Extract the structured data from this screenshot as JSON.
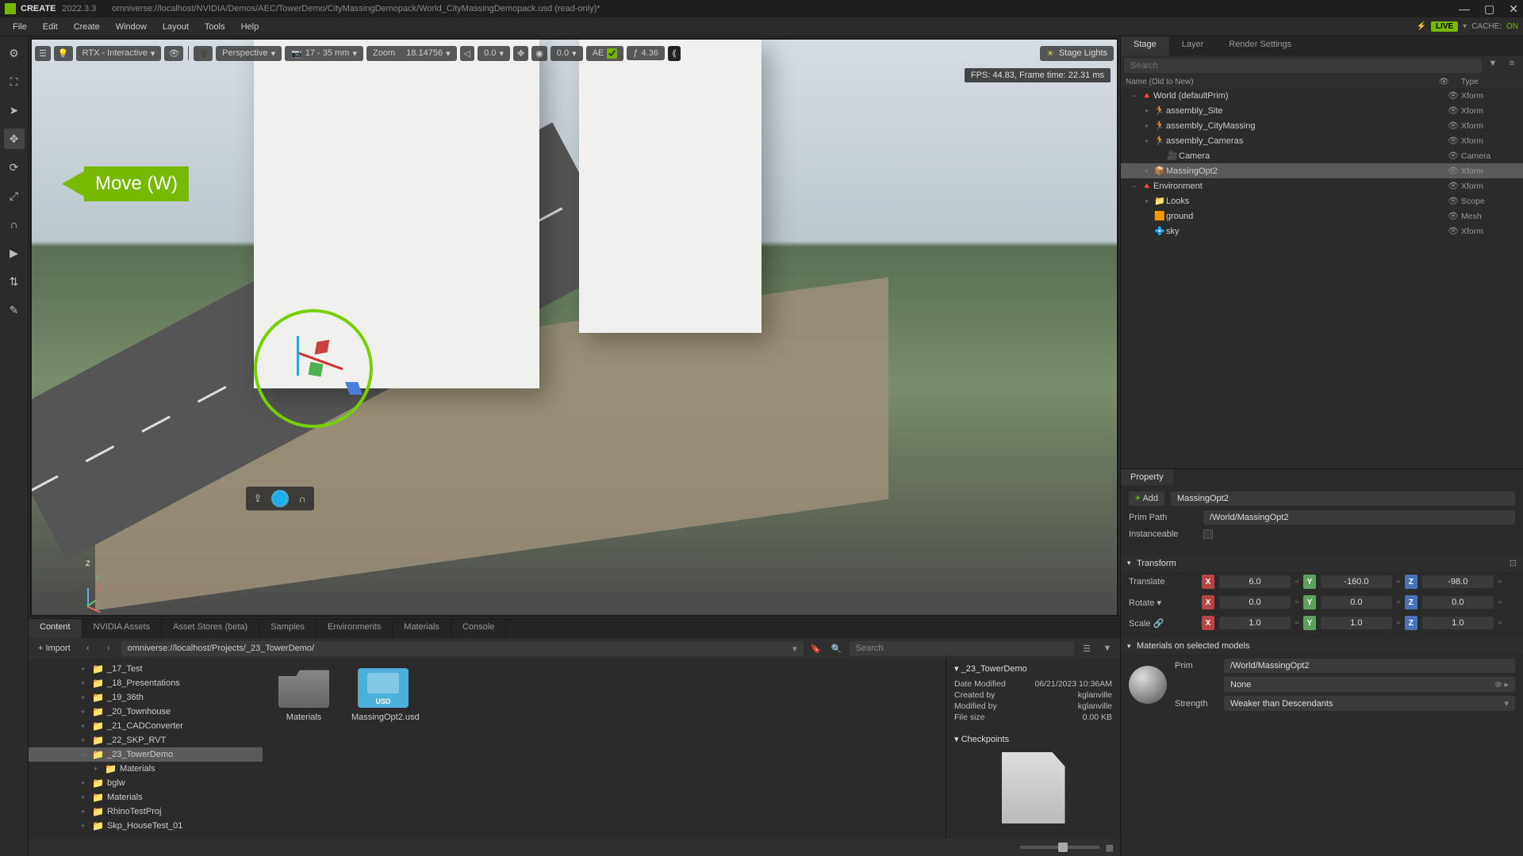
{
  "titlebar": {
    "app": "CREATE",
    "version": "2022.3.3",
    "path": "omniverse://localhost/NVIDIA/Demos/AEC/TowerDemo/CityMassingDemopack/World_CityMassingDemopack.usd (read-only)*"
  },
  "menubar": {
    "items": [
      "File",
      "Edit",
      "Create",
      "Window",
      "Layout",
      "Tools",
      "Help"
    ],
    "live": "LIVE",
    "cache_label": "CACHE:",
    "cache_state": "ON"
  },
  "annotation": {
    "label": "Move (W)"
  },
  "viewport_toolbar": {
    "render_mode": "RTX - Interactive",
    "camera": "Perspective",
    "lens": "17 - 35 mm",
    "zoom_label": "Zoom",
    "zoom_value": "18.14756",
    "val1": "0.0",
    "val2": "0.0",
    "ae_label": "AE",
    "fstop": "4.36",
    "stage_lights": "Stage Lights"
  },
  "fps": "FPS: 44.83, Frame time: 22.31 ms",
  "bottom_tabs": [
    "Content",
    "NVIDIA Assets",
    "Asset Stores (beta)",
    "Samples",
    "Environments",
    "Materials",
    "Console"
  ],
  "content": {
    "import": "Import",
    "path": "omniverse://localhost/Projects/_23_TowerDemo/",
    "search_placeholder": "Search",
    "folders": [
      {
        "name": "_17_Test",
        "depth": 1,
        "exp": "+"
      },
      {
        "name": "_18_Presentations",
        "depth": 1,
        "exp": "+"
      },
      {
        "name": "_19_36th",
        "depth": 1,
        "exp": "+"
      },
      {
        "name": "_20_Townhouse",
        "depth": 1,
        "exp": "+"
      },
      {
        "name": "_21_CADConverter",
        "depth": 1,
        "exp": "+"
      },
      {
        "name": "_22_SKP_RVT",
        "depth": 1,
        "exp": "+"
      },
      {
        "name": "_23_TowerDemo",
        "depth": 1,
        "exp": "−",
        "selected": true
      },
      {
        "name": "Materials",
        "depth": 2,
        "exp": "+"
      },
      {
        "name": "bglw",
        "depth": 1,
        "exp": "+"
      },
      {
        "name": "Materials",
        "depth": 1,
        "exp": "+"
      },
      {
        "name": "RhinoTestProj",
        "depth": 1,
        "exp": "+"
      },
      {
        "name": "Skp_HouseTest_01",
        "depth": 1,
        "exp": "+"
      }
    ],
    "assets": [
      {
        "label": "Materials",
        "type": "folder"
      },
      {
        "label": "MassingOpt2.usd",
        "type": "usd"
      }
    ],
    "detail": {
      "title": "_23_TowerDemo",
      "rows": [
        {
          "k": "Date Modified",
          "v": "06/21/2023 10:36AM"
        },
        {
          "k": "Created by",
          "v": "kglanville"
        },
        {
          "k": "Modified by",
          "v": "kglanville"
        },
        {
          "k": "File size",
          "v": "0.00 KB"
        }
      ],
      "checkpoints": "Checkpoints"
    }
  },
  "right_tabs": [
    "Stage",
    "Layer",
    "Render Settings"
  ],
  "stage": {
    "search_placeholder": "Search",
    "header_name": "Name (Old to New)",
    "header_type": "Type",
    "rows": [
      {
        "depth": 0,
        "exp": "−",
        "ico": "🔺",
        "label": "World (defaultPrim)",
        "type": "Xform",
        "color": "#b8860b"
      },
      {
        "depth": 1,
        "exp": "+",
        "ico": "🏃",
        "label": "assembly_Site",
        "type": "Xform",
        "color": "#4fc3f7"
      },
      {
        "depth": 1,
        "exp": "+",
        "ico": "🏃",
        "label": "assembly_CityMassing",
        "type": "Xform",
        "color": "#4fc3f7"
      },
      {
        "depth": 1,
        "exp": "+",
        "ico": "🏃",
        "label": "assembly_Cameras",
        "type": "Xform",
        "color": "#4fc3f7"
      },
      {
        "depth": 2,
        "exp": "",
        "ico": "🎥",
        "label": "Camera",
        "type": "Camera",
        "color": "#aaa"
      },
      {
        "depth": 1,
        "exp": "+",
        "ico": "📦",
        "label": "MassingOpt2",
        "type": "Xform",
        "selected": true,
        "color": "#7fb8e6"
      },
      {
        "depth": 0,
        "exp": "−",
        "ico": "🔺",
        "label": "Environment",
        "type": "Xform",
        "color": "#b8860b"
      },
      {
        "depth": 1,
        "exp": "+",
        "ico": "📁",
        "label": "Looks",
        "type": "Scope",
        "color": "#aaa"
      },
      {
        "depth": 1,
        "exp": "",
        "ico": "🟧",
        "label": "ground",
        "type": "Mesh",
        "color": "#e6a05a"
      },
      {
        "depth": 1,
        "exp": "",
        "ico": "💠",
        "label": "sky",
        "type": "Xform",
        "color": "#7fb8e6"
      }
    ]
  },
  "property": {
    "tab": "Property",
    "add": "Add",
    "name": "MassingOpt2",
    "prim_path_label": "Prim Path",
    "prim_path": "/World/MassingOpt2",
    "instanceable_label": "Instanceable",
    "transform_label": "Transform",
    "translate_label": "Translate",
    "rotate_label": "Rotate",
    "scale_label": "Scale",
    "translate": {
      "x": "6.0",
      "y": "-160.0",
      "z": "-98.0"
    },
    "rotate": {
      "x": "0.0",
      "y": "0.0",
      "z": "0.0"
    },
    "scale": {
      "x": "1.0",
      "y": "1.0",
      "z": "1.0"
    },
    "materials_label": "Materials on selected models",
    "mat_prim_label": "Prim",
    "mat_prim": "/World/MassingOpt2",
    "mat_none": "None",
    "mat_strength_label": "Strength",
    "mat_strength": "Weaker than Descendants"
  }
}
